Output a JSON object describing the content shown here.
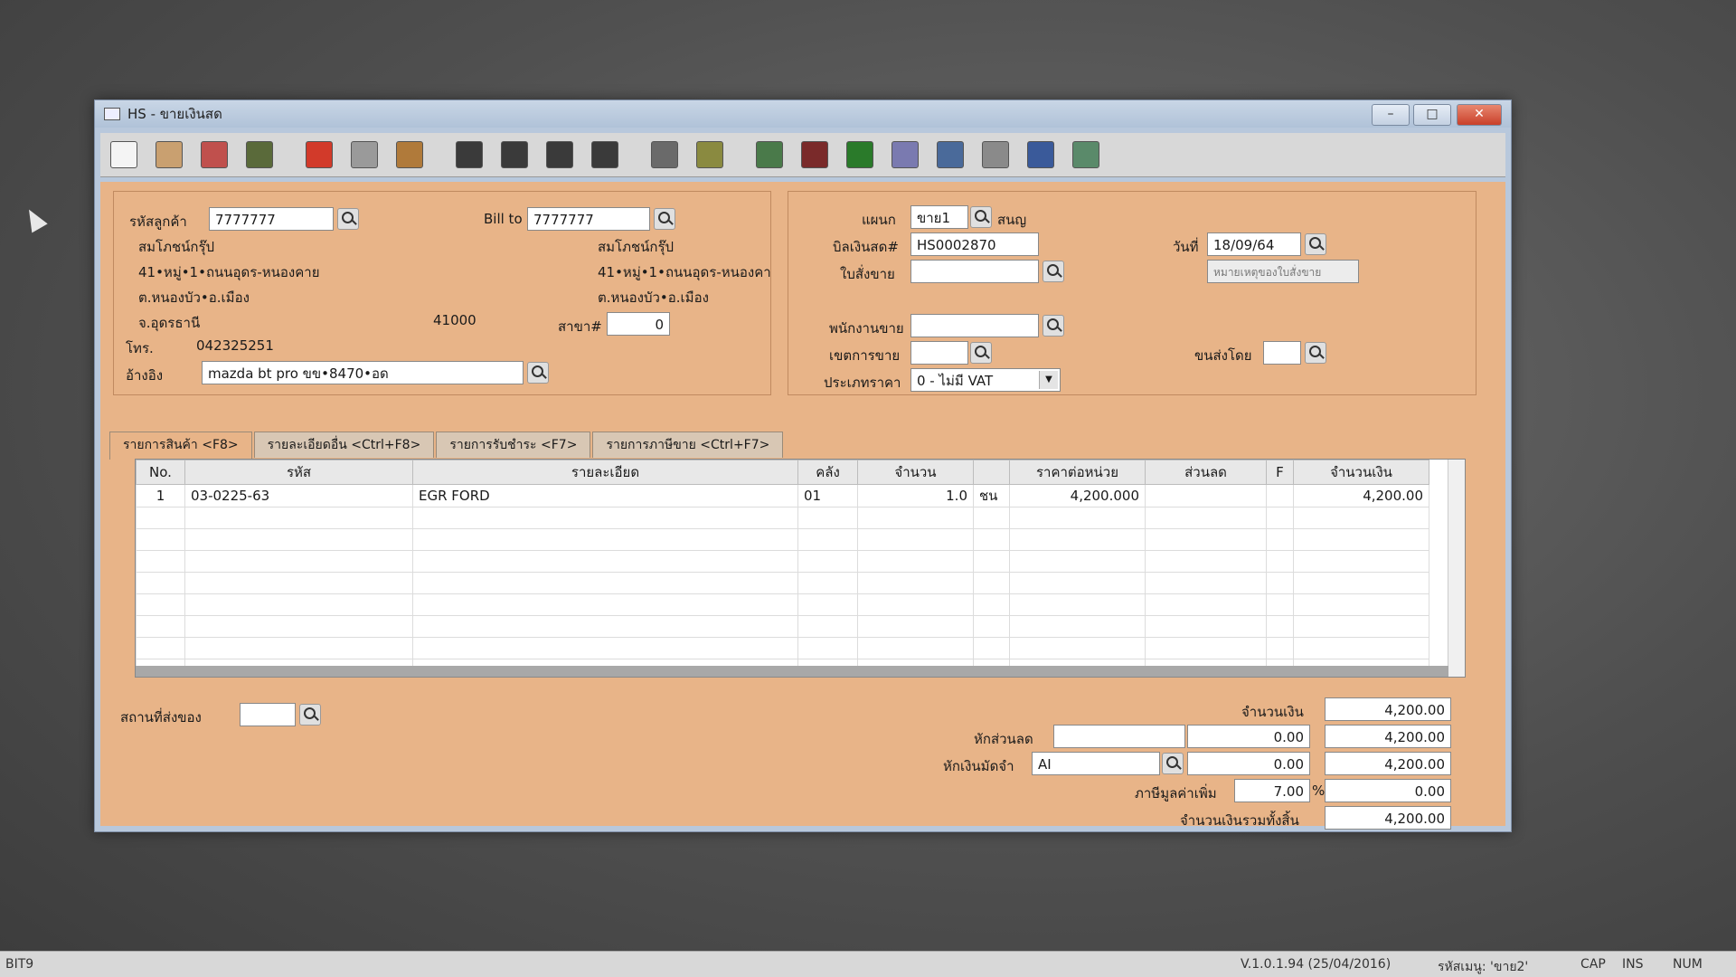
{
  "window": {
    "title": "HS - ขายเงินสด",
    "min": "–",
    "max": "□",
    "close": "✕"
  },
  "toolbar": {
    "buttons": [
      {
        "name": "new-doc-icon",
        "color": "#f4f4f4"
      },
      {
        "name": "edit-icon",
        "color": "#c9a070"
      },
      {
        "name": "void-icon",
        "color": "#c0504d"
      },
      {
        "name": "trash-icon",
        "color": "#5a6a3a"
      },
      {
        "name": "cancel-icon",
        "color": "#d23a2a"
      },
      {
        "name": "save-icon",
        "color": "#9a9a9a"
      },
      {
        "name": "copy-icon",
        "color": "#b07a3a"
      },
      {
        "name": "first-record-icon",
        "color": "#3a3a3a"
      },
      {
        "name": "prev-record-icon",
        "color": "#3a3a3a"
      },
      {
        "name": "next-record-icon",
        "color": "#3a3a3a"
      },
      {
        "name": "last-record-icon",
        "color": "#3a3a3a"
      },
      {
        "name": "find-icon",
        "color": "#6a6a6a"
      },
      {
        "name": "print-icon",
        "color": "#8a8a40"
      },
      {
        "name": "tax-icon",
        "color": "#4a7a4a"
      },
      {
        "name": "report-icon",
        "color": "#7a2a2a"
      },
      {
        "name": "so-icon",
        "color": "#2a7a2a"
      },
      {
        "name": "doc-list-icon",
        "color": "#7a7ab0"
      },
      {
        "name": "approve-icon",
        "color": "#4a6a9a"
      },
      {
        "name": "ok-tools-icon",
        "color": "#8a8a8a"
      },
      {
        "name": "ok-icon",
        "color": "#3a5a9a"
      },
      {
        "name": "transfer-icon",
        "color": "#5a8a6a"
      }
    ]
  },
  "customer": {
    "code_label": "รหัสลูกค้า",
    "code": "7777777",
    "name": "สมโภชน์กรุ๊ป",
    "address1": "41•หมู่•1•ถนนอุดร-หนองคาย",
    "address2": "ต.หนองบัว•อ.เมือง",
    "province": "จ.อุดรธานี",
    "zip": "41000",
    "phone_label": "โทร.",
    "phone": "042325251",
    "ref_label": "อ้างอิง",
    "ref": "mazda bt pro ขข•8470•อด"
  },
  "billto": {
    "label": "Bill to",
    "code": "7777777",
    "name": "สมโภชน์กรุ๊ป",
    "address1": "41•หมู่•1•ถนนอุดร-หนองคา",
    "address2": "ต.หนองบัว•อ.เมือง",
    "branch_label": "สาขา#",
    "branch": "0"
  },
  "doc": {
    "dept_label": "แผนก",
    "dept": "ขาย1",
    "dept_name": "สนญ",
    "bill_label": "บิลเงินสด#",
    "bill": "HS0002870",
    "date_label": "วันที่",
    "date": "18/09/64",
    "order_label": "ใบสั่งขาย",
    "order": "",
    "note_button": "หมายเหตุของใบสั่งขาย",
    "sales_label": "พนักงานขาย",
    "sales": "",
    "area_label": "เขตการขาย",
    "area": "",
    "ship_label": "ขนส่งโดย",
    "ship": "",
    "price_type_label": "ประเภทราคา",
    "price_type": "0 - ไม่มี VAT"
  },
  "tabs": [
    {
      "label": "รายการสินค้า <F8>"
    },
    {
      "label": "รายละเอียดอื่น <Ctrl+F8>"
    },
    {
      "label": "รายการรับชำระ <F7>"
    },
    {
      "label": "รายการภาษีขาย <Ctrl+F7>"
    }
  ],
  "grid": {
    "headers": [
      "No.",
      "รหัส",
      "รายละเอียด",
      "คลัง",
      "จำนวน",
      "",
      "ราคาต่อหน่วย",
      "ส่วนลด",
      "F",
      "จำนวนเงิน"
    ],
    "rows": [
      [
        "1",
        "03-0225-63",
        "EGR FORD",
        "01",
        "1.0",
        "ชน",
        "4,200.000",
        "",
        "",
        "4,200.00"
      ]
    ]
  },
  "footer": {
    "place_label": "สถานที่ส่งของ",
    "place": "",
    "amount_label": "จำนวนเงิน",
    "amount": "4,200.00",
    "discount_label": "หักส่วนลด",
    "discount_text": "",
    "discount": "0.00",
    "after_discount": "4,200.00",
    "deposit_label": "หักเงินมัดจำ",
    "deposit_code": "AI",
    "deposit": "0.00",
    "after_deposit": "4,200.00",
    "vat_label": "ภาษีมูลค่าเพิ่ม",
    "vat_rate": "7.00",
    "vat_pct": "%",
    "vat": "0.00",
    "total_label": "จำนวนเงินรวมทั้งสิ้น",
    "total": "4,200.00"
  },
  "status": {
    "left": "BIT9",
    "version": "V.1.0.1.94 (25/04/2016)",
    "user": "รหัสเมนู: 'ขาย2'",
    "cap": "CAP",
    "ins": "INS",
    "num": "NUM"
  }
}
